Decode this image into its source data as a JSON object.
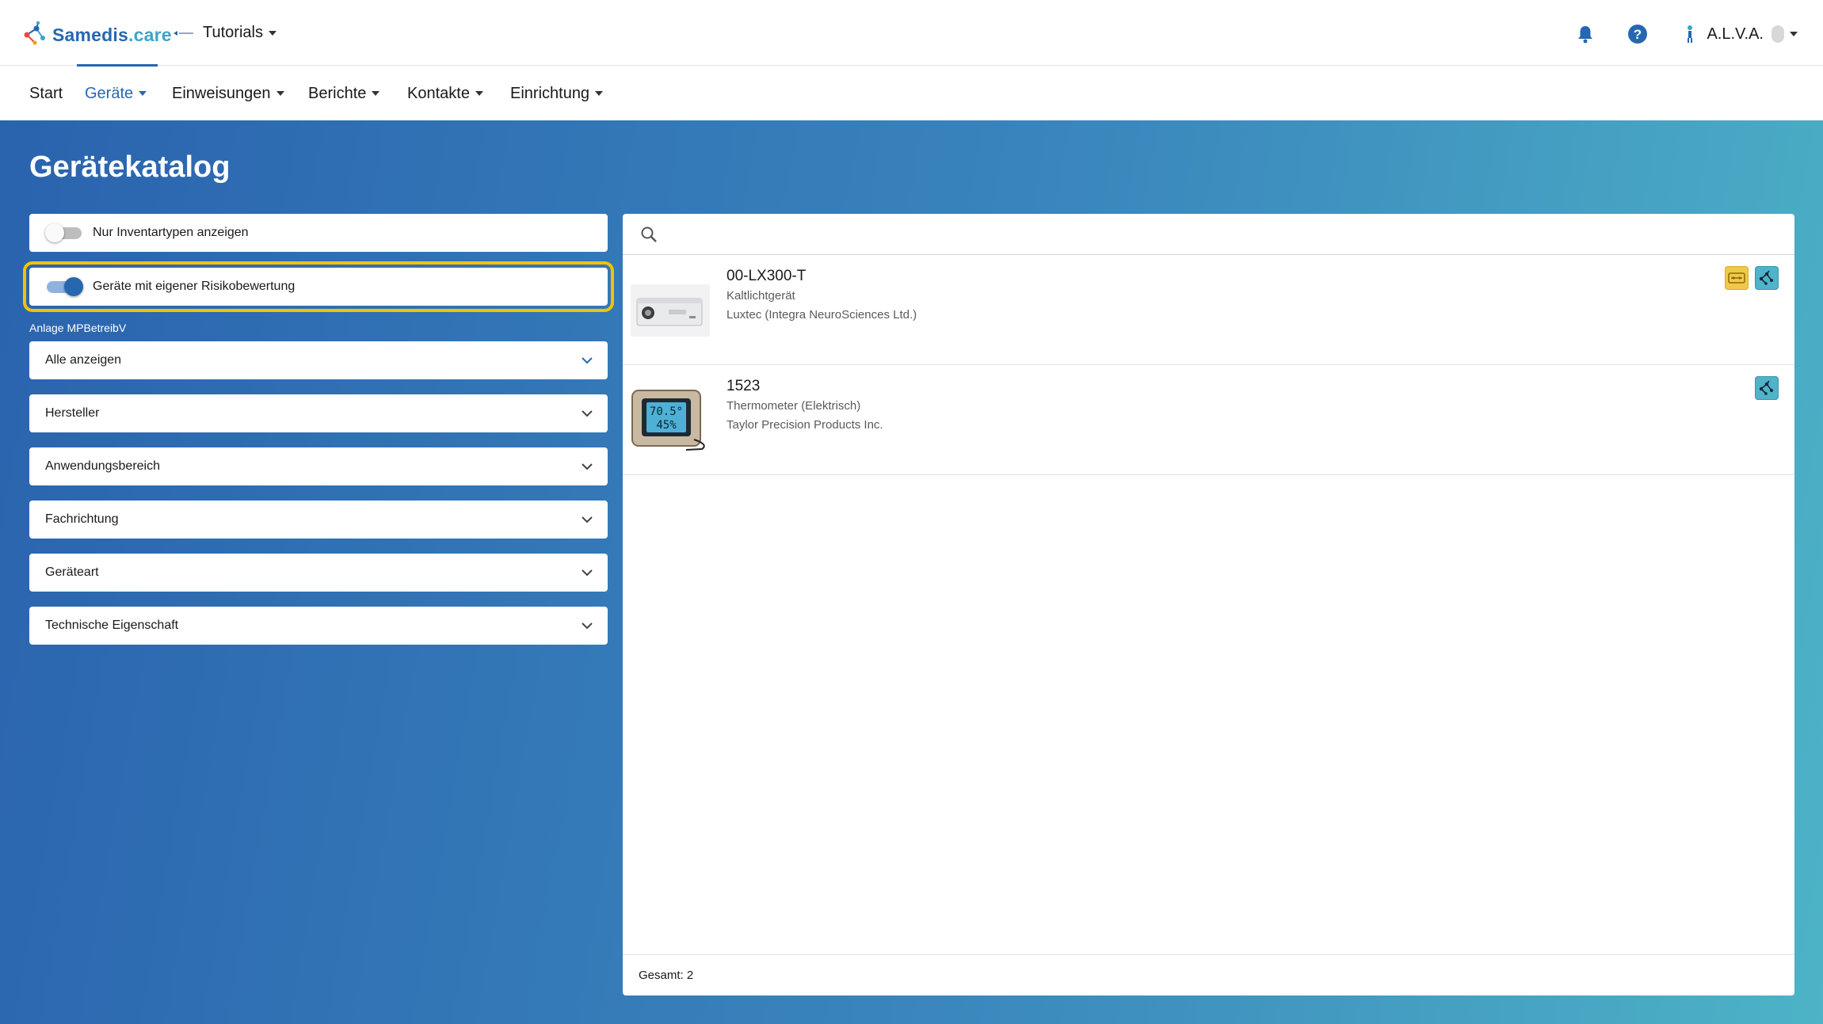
{
  "header": {
    "logo": {
      "brand": "Samedis",
      "suffix": ".care"
    },
    "tenant": {
      "label": "Tutorials"
    },
    "user": {
      "name": "A.L.V.A."
    },
    "icons": [
      "bell-icon",
      "help-icon",
      "user-figure-icon"
    ]
  },
  "nav": {
    "items": [
      {
        "label": "Start"
      },
      {
        "label": "Geräte"
      },
      {
        "label": "Einweisungen"
      },
      {
        "label": "Berichte"
      },
      {
        "label": "Kontakte"
      },
      {
        "label": "Einrichtung"
      }
    ],
    "active": "Geräte"
  },
  "page": {
    "title": "Gerätekatalog"
  },
  "filters": {
    "toggle_inventory": {
      "label": "Nur Inventartypen anzeigen",
      "on": false
    },
    "toggle_risk": {
      "label": "Geräte mit eigener Risikobewertung",
      "on": true
    },
    "anlage": {
      "label": "Anlage MPBetreibV",
      "value": "Alle anzeigen"
    },
    "selects": [
      {
        "label": "Hersteller"
      },
      {
        "label": "Anwendungsbereich"
      },
      {
        "label": "Fachrichtung"
      },
      {
        "label": "Geräteart"
      },
      {
        "label": "Technische Eigenschaft"
      }
    ]
  },
  "results": {
    "search": {
      "placeholder": "",
      "value": ""
    },
    "items": [
      {
        "title": "00-LX300-T",
        "type": "Kaltlichtgerät",
        "manufacturer": "Luxtec (Integra NeuroSciences Ltd.)",
        "badges": [
          "yellow",
          "teal"
        ]
      },
      {
        "title": "1523",
        "type": "Thermometer (Elektrisch)",
        "manufacturer": "Taylor Precision Products Inc.",
        "badges": [
          "teal"
        ]
      }
    ],
    "total_label": "Gesamt: 2"
  },
  "colors": {
    "brand_blue": "#2767b0",
    "brand_teal": "#3aa6c9",
    "highlight": "#f2c300",
    "gradient_start": "#2a63ae",
    "gradient_end": "#4db3c6"
  }
}
